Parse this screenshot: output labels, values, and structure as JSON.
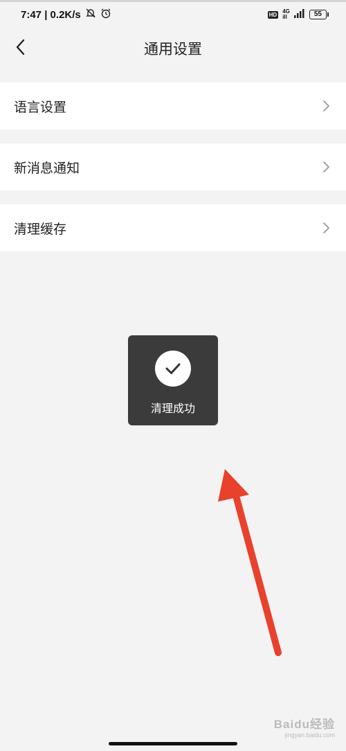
{
  "status_bar": {
    "time_speed": "7:47 | 0.2K/s",
    "hd": "HD",
    "network_top": "4G",
    "network_bottom": "ill",
    "battery": "55"
  },
  "header": {
    "title": "通用设置"
  },
  "settings": {
    "items": [
      {
        "label": "语言设置"
      },
      {
        "label": "新消息通知"
      },
      {
        "label": "清理缓存"
      }
    ]
  },
  "toast": {
    "message": "清理成功"
  },
  "annotation": {
    "arrow_color": "#e8412c"
  },
  "watermark": {
    "brand": "Baidu经验",
    "url": "jingyan.baidu.com"
  },
  "icons": {
    "back": "chevron-left-icon",
    "row_arrow": "chevron-right-icon",
    "toast": "check-circle-icon",
    "mute": "bell-off-icon",
    "alarm": "alarm-clock-icon"
  }
}
